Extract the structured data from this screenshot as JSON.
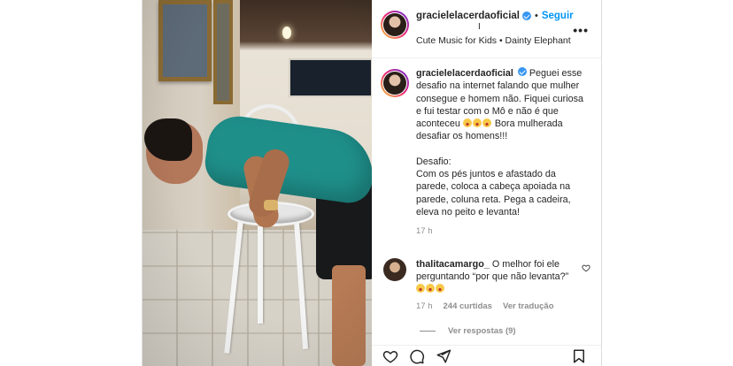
{
  "header": {
    "username": "gracielelacerdaoficial",
    "follow_label": "Seguir",
    "separator": "•",
    "mark": "I",
    "music": "Cute Music for Kids • Dainty Elephant",
    "more": "•••"
  },
  "caption": {
    "username": "gracielelacerdaoficial",
    "text_1": "Peguei esse desafio na internet falando que mulher consegue e homem não. Fiquei curiosa e fui testar com o Mô e não é que aconteceu",
    "text_2": "Bora mulherada desafiar os homens!!!",
    "challenge_title": "Desafio:",
    "challenge_text": "Com os pés juntos e afastado da parede, coloca a cabeça apoiada na parede, coluna reta. Pega a cadeira, eleva no peito e levanta!",
    "time": "17 h"
  },
  "comment": {
    "username": "thalitacamargo_",
    "text": "O melhor foi ele perguntando “por que não levanta?”",
    "time": "17 h",
    "likes": "244 curtidas",
    "translate": "Ver tradução",
    "replies": "Ver respostas (9)"
  },
  "icons": {
    "like": "heart-icon",
    "comment": "comment-icon",
    "share": "paper-plane-icon",
    "save": "bookmark-icon"
  },
  "colors": {
    "follow": "#0095f6",
    "verified": "#3897f0",
    "muted": "#8e8e8e"
  }
}
